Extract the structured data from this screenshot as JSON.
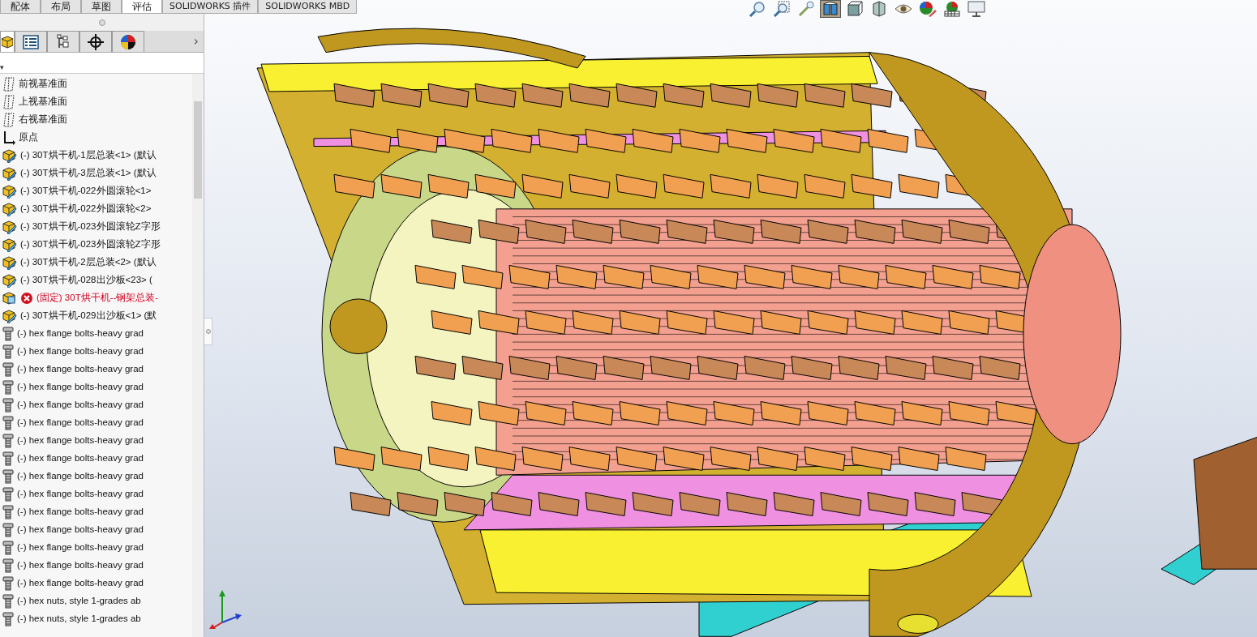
{
  "command_tabs": [
    {
      "label": "配体",
      "selected": false
    },
    {
      "label": "布局",
      "selected": false
    },
    {
      "label": "草图",
      "selected": false
    },
    {
      "label": "评估",
      "selected": true
    },
    {
      "label": "SOLIDWORKS 插件",
      "selected": false
    },
    {
      "label": "SOLIDWORKS MBD",
      "selected": false
    }
  ],
  "panel_tabs": [
    {
      "kind": "tree",
      "selected": true
    },
    {
      "kind": "properties",
      "selected": false
    },
    {
      "kind": "config",
      "selected": false
    },
    {
      "kind": "dimxpert",
      "selected": false
    },
    {
      "kind": "display",
      "selected": false
    }
  ],
  "panel_more": "›",
  "filter_caret": "▾",
  "tree": [
    {
      "kind": "plane",
      "label": "前视基准面"
    },
    {
      "kind": "plane",
      "label": "上视基准面"
    },
    {
      "kind": "plane",
      "label": "右视基准面"
    },
    {
      "kind": "origin",
      "label": "原点"
    },
    {
      "kind": "assembly",
      "label": "(-) 30T烘干机-1层总装<1> (默认"
    },
    {
      "kind": "assembly",
      "label": "(-) 30T烘干机-3层总装<1> (默认"
    },
    {
      "kind": "part",
      "label": "(-) 30T烘干机-022外圆滚轮<1>"
    },
    {
      "kind": "part",
      "label": "(-) 30T烘干机-022外圆滚轮<2>"
    },
    {
      "kind": "part",
      "label": "(-) 30T烘干机-023外圆滚轮Z字形"
    },
    {
      "kind": "part",
      "label": "(-) 30T烘干机-023外圆滚轮Z字形"
    },
    {
      "kind": "assembly",
      "label": "(-) 30T烘干机-2层总装<2> (默认"
    },
    {
      "kind": "part",
      "label": "(-) 30T烘干机-028出沙板<23> ("
    },
    {
      "kind": "error",
      "label": "(固定) 30T烘干机--钢架总装-"
    },
    {
      "kind": "part",
      "label": "(-) 30T烘干机-029出沙板<1> (默"
    },
    {
      "kind": "bolt",
      "label": "(-) hex flange bolts-heavy grad"
    },
    {
      "kind": "bolt",
      "label": "(-) hex flange bolts-heavy grad"
    },
    {
      "kind": "bolt",
      "label": "(-) hex flange bolts-heavy grad"
    },
    {
      "kind": "bolt",
      "label": "(-) hex flange bolts-heavy grad"
    },
    {
      "kind": "bolt",
      "label": "(-) hex flange bolts-heavy grad"
    },
    {
      "kind": "bolt",
      "label": "(-) hex flange bolts-heavy grad"
    },
    {
      "kind": "bolt",
      "label": "(-) hex flange bolts-heavy grad"
    },
    {
      "kind": "bolt",
      "label": "(-) hex flange bolts-heavy grad"
    },
    {
      "kind": "bolt",
      "label": "(-) hex flange bolts-heavy grad"
    },
    {
      "kind": "bolt",
      "label": "(-) hex flange bolts-heavy grad"
    },
    {
      "kind": "bolt",
      "label": "(-) hex flange bolts-heavy grad"
    },
    {
      "kind": "bolt",
      "label": "(-) hex flange bolts-heavy grad"
    },
    {
      "kind": "bolt",
      "label": "(-) hex flange bolts-heavy grad"
    },
    {
      "kind": "bolt",
      "label": "(-) hex flange bolts-heavy grad"
    },
    {
      "kind": "bolt",
      "label": "(-) hex flange bolts-heavy grad"
    },
    {
      "kind": "bolt",
      "label": "(-) hex nuts, style 1-grades ab"
    },
    {
      "kind": "bolt",
      "label": "(-) hex nuts, style 1-grades ab"
    }
  ],
  "view_toolbar": [
    {
      "kind": "zoom-fit"
    },
    {
      "kind": "zoom-area"
    },
    {
      "kind": "previous"
    },
    {
      "kind": "section",
      "selected": true
    },
    {
      "kind": "orientation"
    },
    {
      "kind": "display-style"
    },
    {
      "kind": "hide-show"
    },
    {
      "kind": "edit-appearance"
    },
    {
      "kind": "scene"
    },
    {
      "kind": "view-settings"
    }
  ]
}
